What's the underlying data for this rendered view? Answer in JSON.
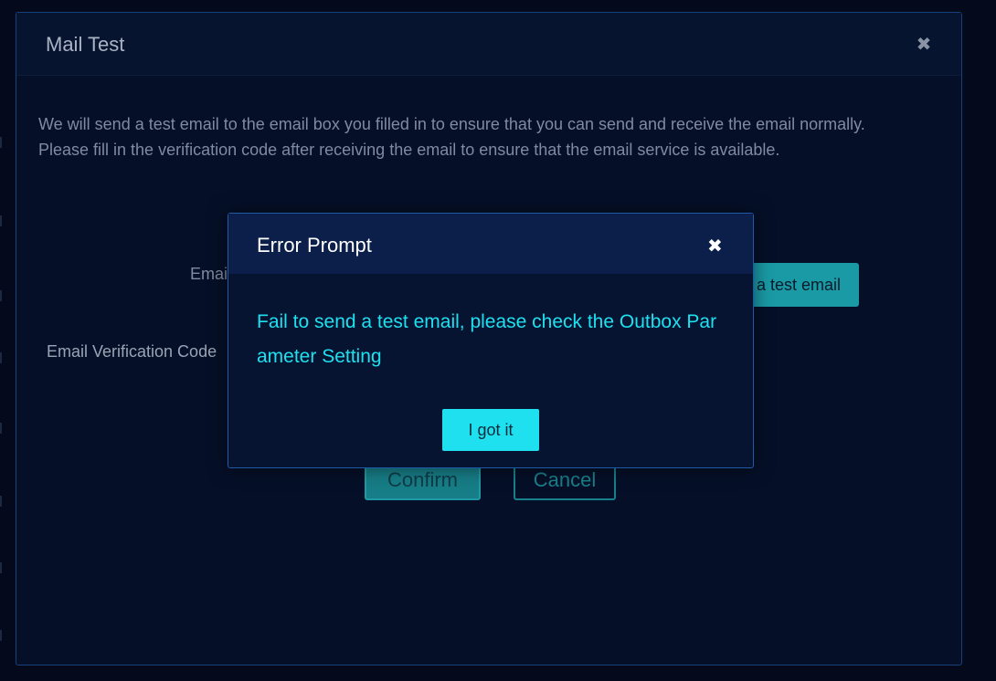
{
  "mail_modal": {
    "title": "Mail Test",
    "close_icon": "close-icon",
    "description": "We will send a test email to the email box you filled in to ensure that you can send and receive the email normally. Please fill in the verification code after receiving the email to ensure that the email service is available.",
    "email_label": "Emai",
    "send_button_label": "a test email",
    "code_label": "Email Verification Code",
    "confirm_label": "Confirm",
    "cancel_label": "Cancel"
  },
  "error_modal": {
    "title": "Error Prompt",
    "close_icon": "close-icon",
    "message": "Fail to send a test email, please check the Outbox Parameter Setting",
    "ok_label": "I got it",
    "message_color": "#1ee0ef"
  },
  "colors": {
    "accent": "#1ee0ef",
    "teal_button": "#1a9aa5",
    "background": "#040a1b"
  }
}
